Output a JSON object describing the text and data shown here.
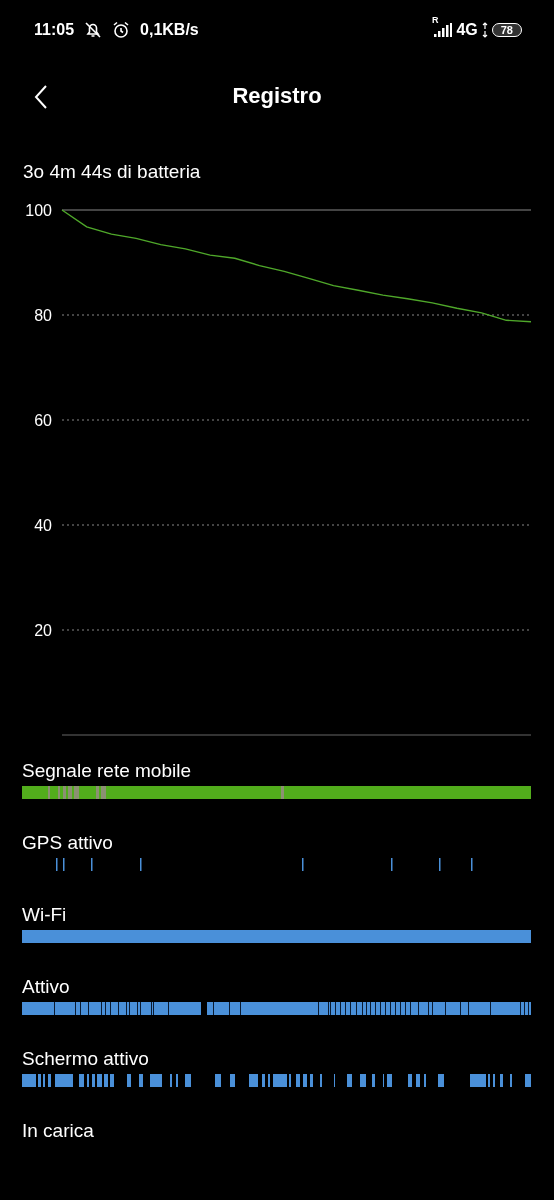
{
  "status_bar": {
    "time": "11:05",
    "speed": "0,1KB/s",
    "roaming": "R",
    "network": "4G",
    "battery": "78"
  },
  "header": {
    "title": "Registro"
  },
  "summary": "3o 4m 44s di batteria",
  "chart": {
    "chart_data": {
      "type": "line",
      "grid": true,
      "series": [
        {
          "color": "#4fa82a",
          "values": [
            100,
            96.8,
            95.4,
            94.6,
            93.4,
            92.6,
            91.4,
            90.8,
            89.4,
            88.3,
            87.0,
            85.6,
            84.7,
            83.8,
            83.1,
            82.3,
            81.3,
            80.4,
            79.0,
            78.7
          ]
        }
      ],
      "ylim": [
        0,
        100
      ],
      "yticks": [
        20,
        40,
        60,
        80,
        100
      ]
    }
  },
  "rows": [
    {
      "label": "Segnale rete mobile",
      "kind": "signal",
      "color": "#52ad1c"
    },
    {
      "label": "GPS attivo",
      "kind": "ticks",
      "color": "#4a90d9"
    },
    {
      "label": "Wi-Fi",
      "kind": "solid",
      "color": "#4a90d9"
    },
    {
      "label": "Attivo",
      "kind": "dense",
      "color": "#4a90d9"
    },
    {
      "label": "Schermo attivo",
      "kind": "segments",
      "color": "#4a90d9"
    },
    {
      "label": "In carica",
      "kind": "empty"
    }
  ]
}
